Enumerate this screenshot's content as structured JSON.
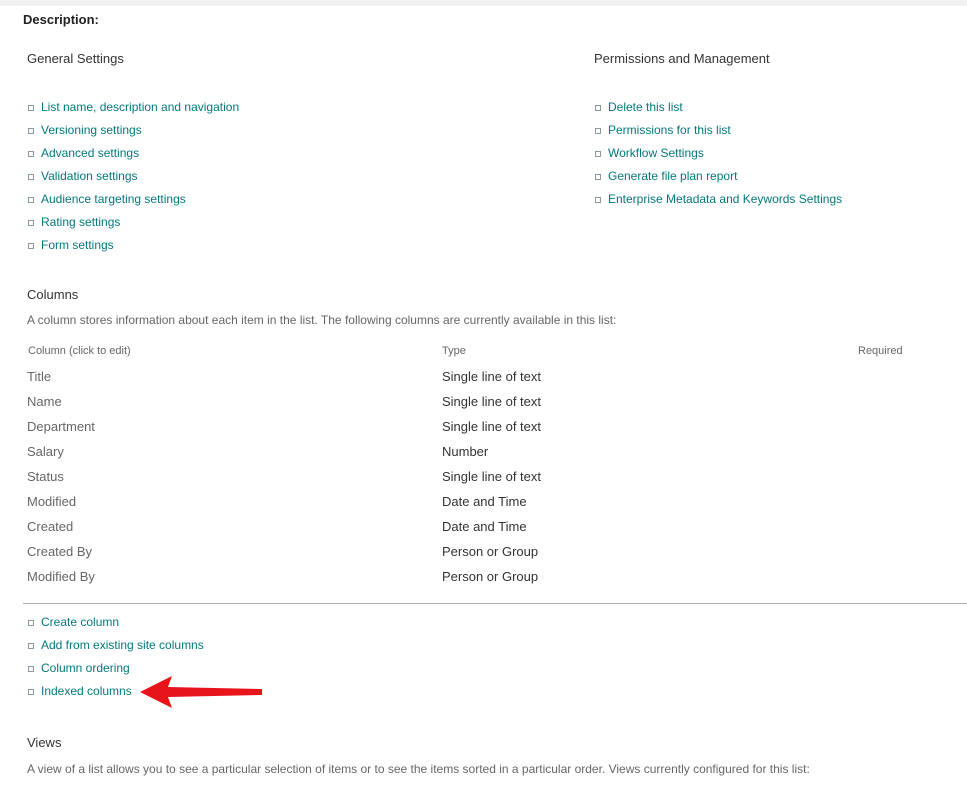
{
  "description_label": "Description:",
  "general_settings": {
    "heading": "General Settings",
    "links": [
      "List name, description and navigation",
      "Versioning settings",
      "Advanced settings",
      "Validation settings",
      "Audience targeting settings",
      "Rating settings",
      "Form settings"
    ]
  },
  "permissions": {
    "heading": "Permissions and Management",
    "links": [
      "Delete this list",
      "Permissions for this list",
      "Workflow Settings",
      "Generate file plan report",
      "Enterprise Metadata and Keywords Settings"
    ]
  },
  "columns": {
    "heading": "Columns",
    "description": "A column stores information about each item in the list. The following columns are currently available in this list:",
    "headers": {
      "column": "Column (click to edit)",
      "type": "Type",
      "required": "Required"
    },
    "rows": [
      {
        "name": "Title",
        "type": "Single line of text"
      },
      {
        "name": "Name",
        "type": "Single line of text"
      },
      {
        "name": "Department",
        "type": "Single line of text"
      },
      {
        "name": "Salary",
        "type": "Number"
      },
      {
        "name": "Status",
        "type": "Single line of text"
      },
      {
        "name": "Modified",
        "type": "Date and Time"
      },
      {
        "name": "Created",
        "type": "Date and Time"
      },
      {
        "name": "Created By",
        "type": "Person or Group"
      },
      {
        "name": "Modified By",
        "type": "Person or Group"
      }
    ],
    "actions": [
      "Create column",
      "Add from existing site columns",
      "Column ordering",
      "Indexed columns"
    ]
  },
  "views": {
    "heading": "Views",
    "description": "A view of a list allows you to see a particular selection of items or to see the items sorted in a particular order. Views currently configured for this list:"
  },
  "colors": {
    "link": "#03787c",
    "annotation_arrow": "#e8141b"
  },
  "annotation": {
    "arrow_icon": "red-arrow-icon",
    "points_to": "Indexed columns"
  }
}
